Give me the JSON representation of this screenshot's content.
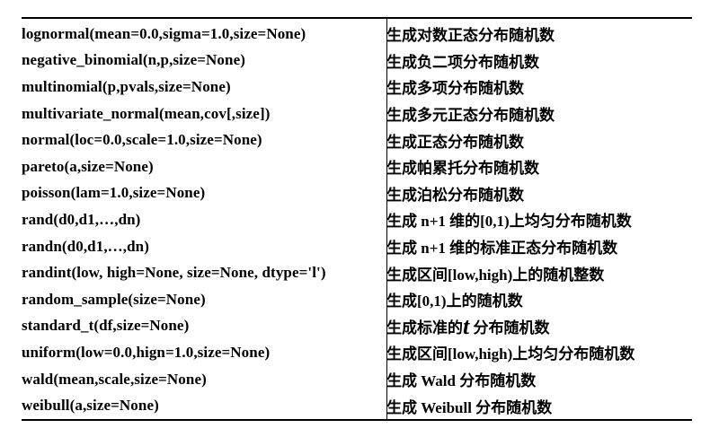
{
  "table": {
    "rows": [
      {
        "func": "lognormal(mean=0.0,sigma=1.0,size=None)",
        "desc": "生成对数正态分布随机数"
      },
      {
        "func": "negative_binomial(n,p,size=None)",
        "desc": "生成负二项分布随机数"
      },
      {
        "func": "multinomial(p,pvals,size=None)",
        "desc": "生成多项分布随机数"
      },
      {
        "func": "multivariate_normal(mean,cov[,size])",
        "desc": "生成多元正态分布随机数"
      },
      {
        "func": "normal(loc=0.0,scale=1.0,size=None)",
        "desc": "生成正态分布随机数"
      },
      {
        "func": "pareto(a,size=None)",
        "desc": "生成帕累托分布随机数"
      },
      {
        "func": "poisson(lam=1.0,size=None)",
        "desc": "生成泊松分布随机数"
      },
      {
        "func": "rand(d0,d1,…,dn)",
        "desc": "生成 n+1 维的[0,1)上均匀分布随机数"
      },
      {
        "func": "randn(d0,d1,…,dn)",
        "desc": "生成 n+1 维的标准正态分布随机数"
      },
      {
        "func": "randint(low, high=None, size=None, dtype='l')",
        "desc": "生成区间[low,high)上的随机整数"
      },
      {
        "func": "random_sample(size=None)",
        "desc": "生成[0,1)上的随机数"
      },
      {
        "func": "standard_t(df,size=None)",
        "desc_prefix": "生成标准的",
        "desc_t": "t",
        "desc_suffix": " 分布随机数"
      },
      {
        "func": "uniform(low=0.0,hign=1.0,size=None)",
        "desc": "生成区间[low,high)上均匀分布随机数"
      },
      {
        "func": "wald(mean,scale,size=None)",
        "desc": "生成 Wald 分布随机数"
      },
      {
        "func": "weibull(a,size=None)",
        "desc": "生成 Weibull 分布随机数"
      }
    ]
  }
}
